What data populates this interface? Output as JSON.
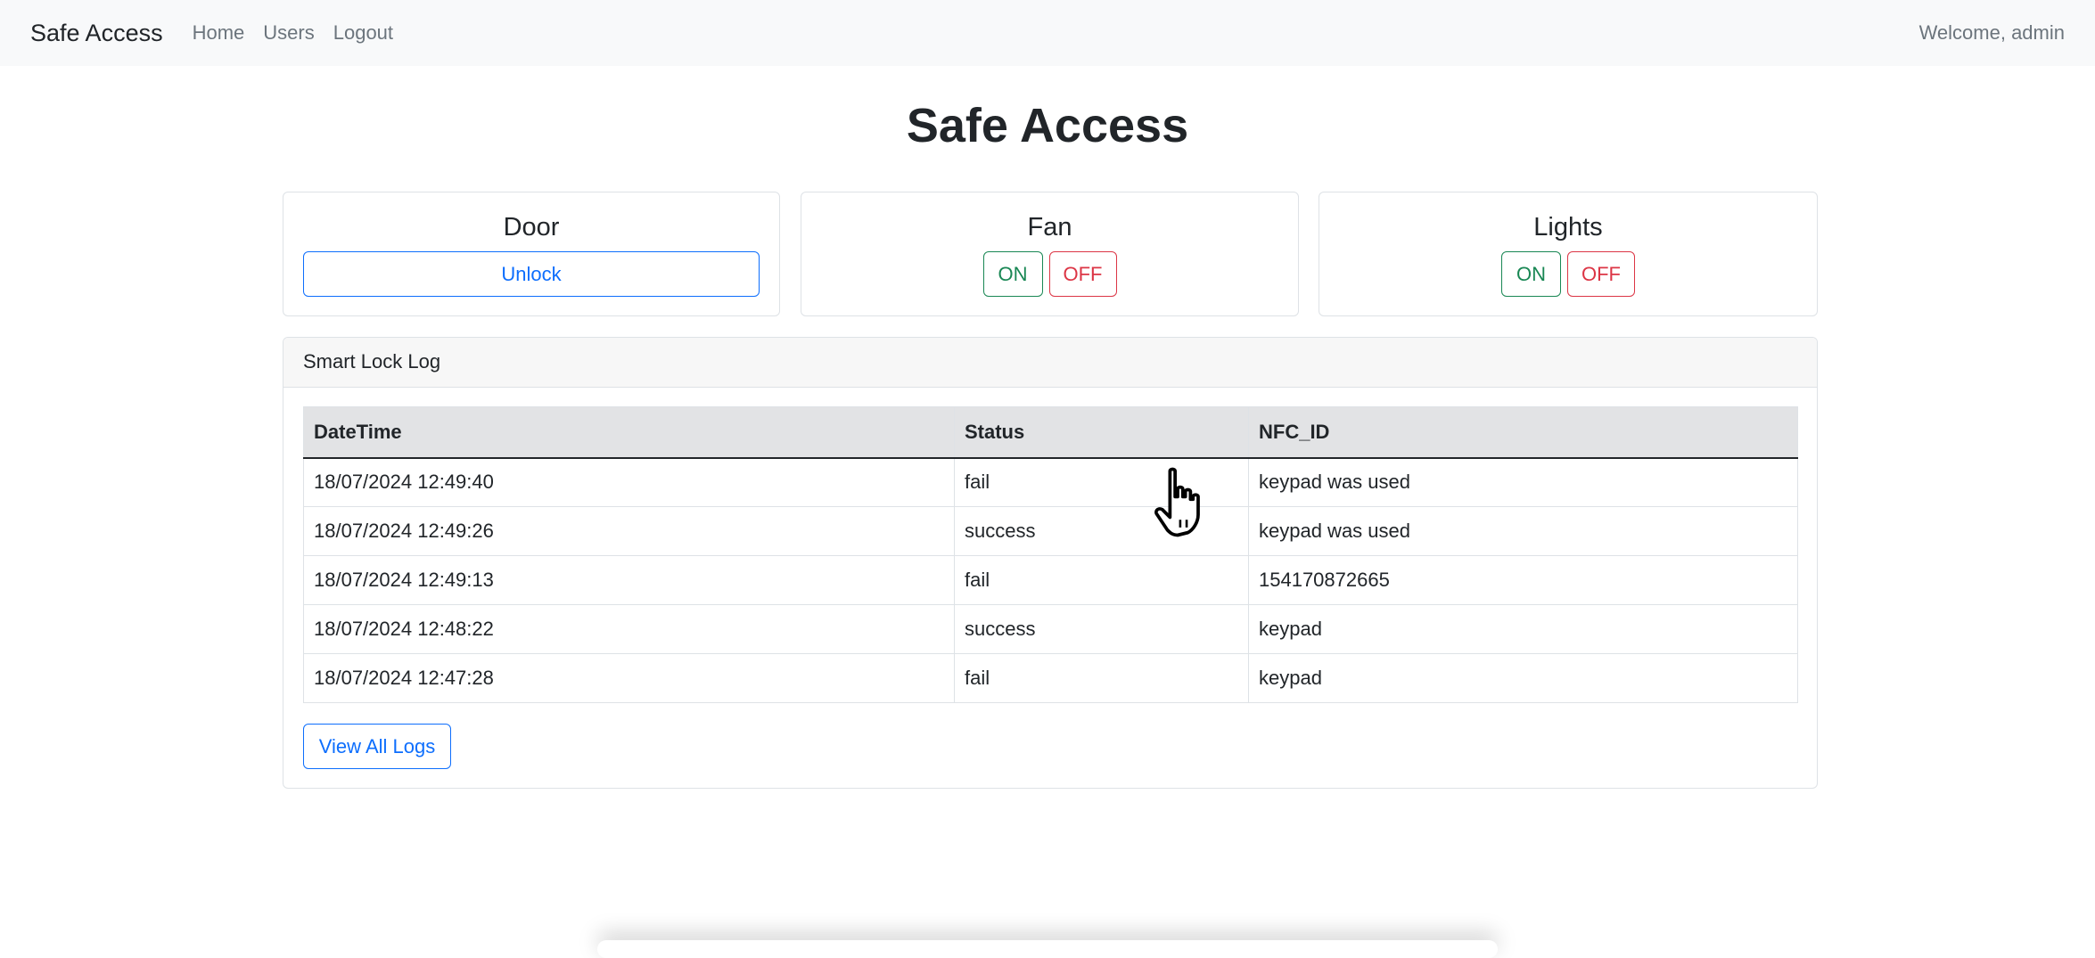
{
  "navbar": {
    "brand": "Safe Access",
    "links": [
      {
        "label": "Home"
      },
      {
        "label": "Users"
      },
      {
        "label": "Logout"
      }
    ],
    "welcome": "Welcome, admin"
  },
  "page_title": "Safe Access",
  "controls": {
    "door": {
      "title": "Door",
      "unlock_label": "Unlock"
    },
    "fan": {
      "title": "Fan",
      "on_label": "ON",
      "off_label": "OFF"
    },
    "lights": {
      "title": "Lights",
      "on_label": "ON",
      "off_label": "OFF"
    }
  },
  "log": {
    "header": "Smart Lock Log",
    "columns": [
      "DateTime",
      "Status",
      "NFC_ID"
    ],
    "rows": [
      {
        "datetime": "18/07/2024 12:49:40",
        "status": "fail",
        "nfc_id": "keypad was used"
      },
      {
        "datetime": "18/07/2024 12:49:26",
        "status": "success",
        "nfc_id": "keypad was used"
      },
      {
        "datetime": "18/07/2024 12:49:13",
        "status": "fail",
        "nfc_id": "154170872665"
      },
      {
        "datetime": "18/07/2024 12:48:22",
        "status": "success",
        "nfc_id": "keypad"
      },
      {
        "datetime": "18/07/2024 12:47:28",
        "status": "fail",
        "nfc_id": "keypad"
      }
    ],
    "view_all_label": "View All Logs"
  },
  "colors": {
    "primary": "#0d6efd",
    "success": "#198754",
    "danger": "#dc3545",
    "navbar_bg": "#f8f9fa"
  },
  "icons": {
    "cursor": "hand-pointer-icon"
  }
}
